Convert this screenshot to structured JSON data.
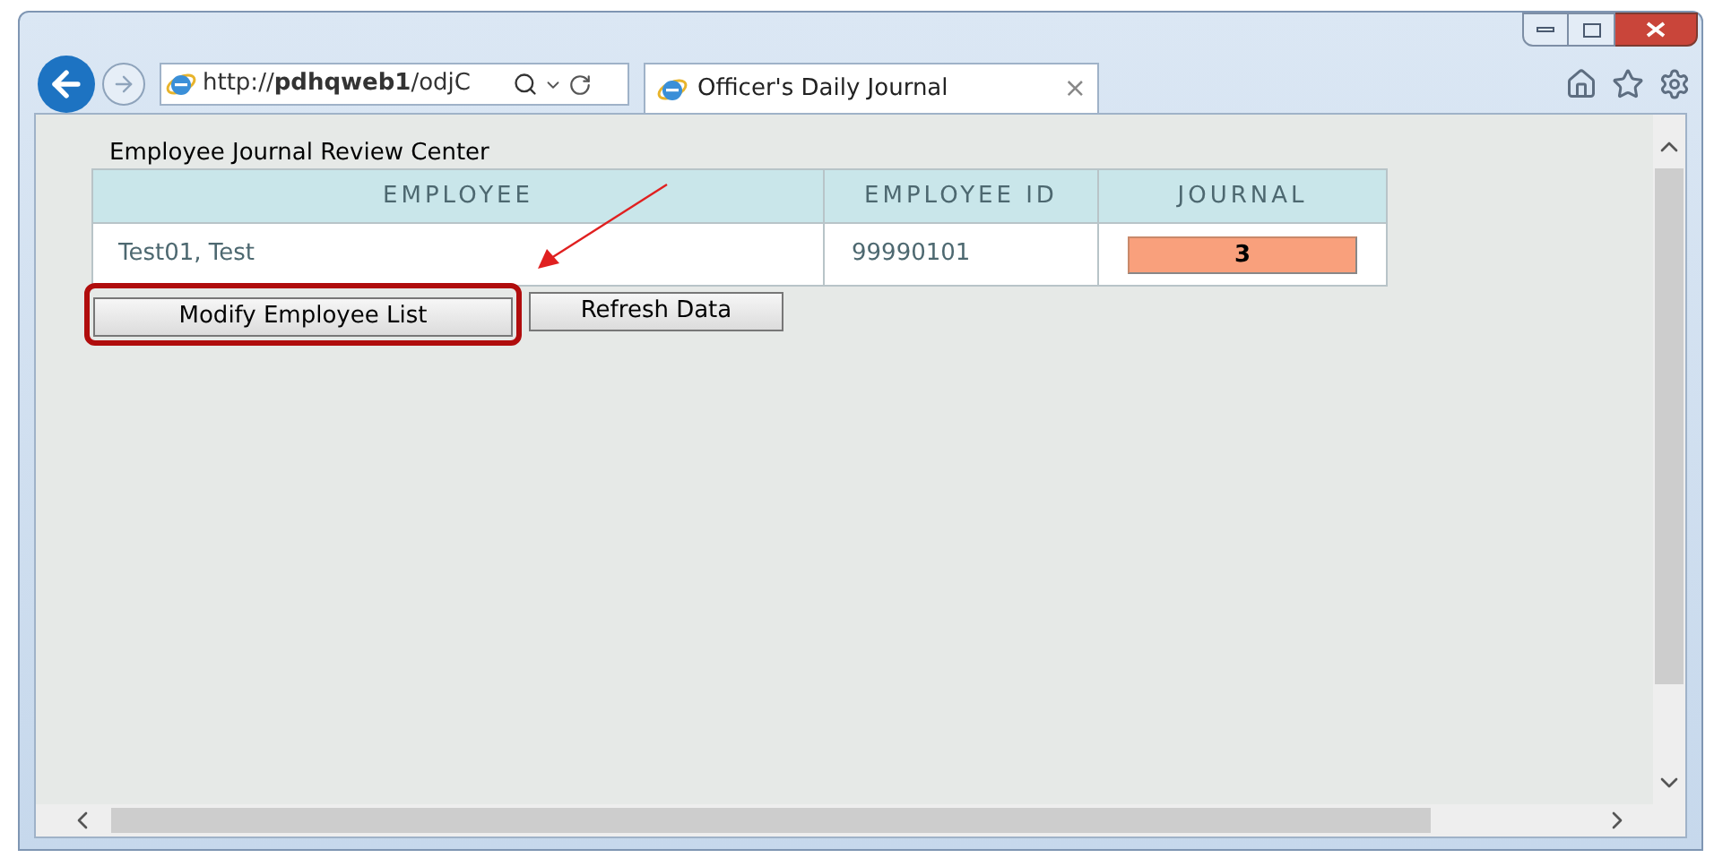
{
  "browser": {
    "address": "http://**pdhqweb1**/odjC",
    "tab_title": "Officer's Daily Journal",
    "tab_close": "×"
  },
  "page": {
    "title": "Employee Journal Review Center",
    "table": {
      "columns": [
        "EMPLOYEE",
        "EMPLOYEE ID",
        "JOURNAL"
      ],
      "rows": [
        {
          "employee": "Test01, Test",
          "employee_id": "99990101",
          "journal": "3"
        }
      ]
    },
    "buttons": [
      {
        "label": "Modify Employee List",
        "highlighted": true
      },
      {
        "label": "Refresh Data",
        "highlighted": false
      }
    ]
  }
}
